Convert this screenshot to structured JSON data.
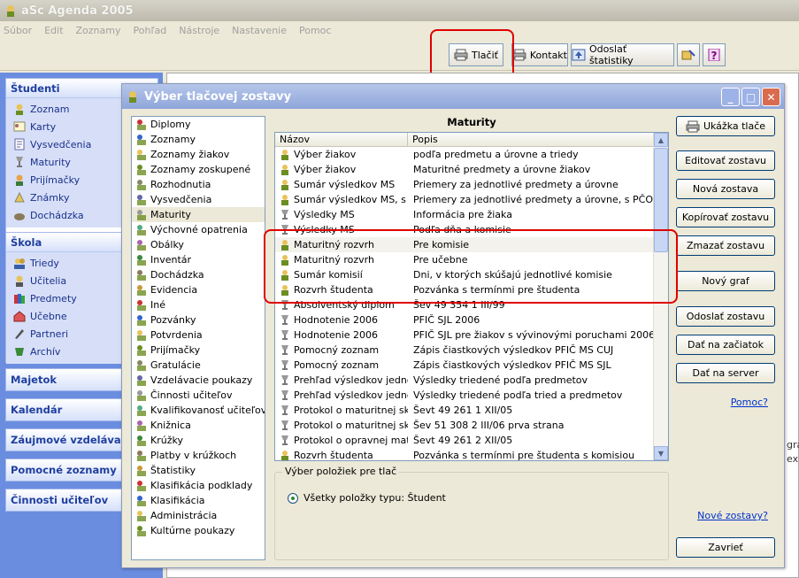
{
  "app": {
    "title": "aSc Agenda 2005"
  },
  "menu": [
    "Súbor",
    "Edit",
    "Zoznamy",
    "Pohľad",
    "Nástroje",
    "Nastavenie",
    "Pomoc"
  ],
  "toolbar": {
    "print_label": "Tlačiť",
    "contact_label": "Kontakt",
    "stats_label": "Odoslať štatistiky"
  },
  "nav": {
    "students": {
      "title": "Študenti",
      "items": [
        "Zoznam",
        "Karty",
        "Vysvedčenia",
        "Maturity",
        "Prijímačky",
        "Známky",
        "Dochádzka"
      ]
    },
    "school": {
      "title": "Škola",
      "items": [
        "Triedy",
        "Učitelia",
        "Predmety",
        "Učebne",
        "Partneri",
        "Archív"
      ]
    },
    "collapsed": [
      "Majetok",
      "Kalendár",
      "Záujmové vzdelávanie",
      "Pomocné zoznamy",
      "Činnosti učiteľov"
    ]
  },
  "dialog": {
    "title": "Výber tlačovej zostavy",
    "categories": [
      "Diplomy",
      "Zoznamy",
      "Zoznamy žiakov",
      "Zoznamy zoskupené",
      "Rozhodnutia",
      "Vysvedčenia",
      "Maturity",
      "Výchovné opatrenia",
      "Obálky",
      "Inventár",
      "Dochádzka",
      "Evidencia",
      "Iné",
      "Pozvánky",
      "Potvrdenia",
      "Prijímačky",
      "Gratulácie",
      "Vzdelávacie poukazy",
      "Činnosti učiteľov",
      "Kvalifikovanosť učiteľov",
      "Knižnica",
      "Krúžky",
      "Platby v krúžkoch",
      "Štatistiky",
      "Klasifikácia podklady",
      "Klasifikácia",
      "Administrácia",
      "Kultúrne poukazy"
    ],
    "selected_category": "Maturity",
    "panel_title": "Maturity",
    "columns": {
      "name": "Názov",
      "description": "Popis"
    },
    "rows": [
      {
        "name": "Výber žiakov",
        "desc": "podľa predmetu a úrovne a triedy"
      },
      {
        "name": "Výber žiakov",
        "desc": "Maturitné predmety a úrovne žiakov"
      },
      {
        "name": "Sumár výsledkov MS",
        "desc": "Priemery za jednotlivé predmety a úrovne"
      },
      {
        "name": "Sumár výsledkov MS, s ...",
        "desc": "Priemery za jednotlivé predmety a úrovne, s PČOZ"
      },
      {
        "name": "Výsledky MS",
        "desc": "Informácia pre žiaka"
      },
      {
        "name": "Výsledky MS",
        "desc": "Podľa dňa a komisie"
      },
      {
        "name": "Maturitný rozvrh",
        "desc": "Pre komisie"
      },
      {
        "name": "Maturitný rozvrh",
        "desc": "Pre učebne"
      },
      {
        "name": "Sumár komisií",
        "desc": "Dni, v ktorých skúšajú jednotlivé komisie"
      },
      {
        "name": "Rozvrh študenta",
        "desc": "Pozvánka s termínmi pre študenta"
      },
      {
        "name": "Absolventský diplom",
        "desc": "Šev 49 354 1 III/99"
      },
      {
        "name": "Hodnotenie 2006",
        "desc": "PFIČ SJL 2006"
      },
      {
        "name": "Hodnotenie 2006",
        "desc": "PFIČ SJL pre žiakov s vývinovými poruchami 2006"
      },
      {
        "name": "Pomocný zoznam",
        "desc": "Zápis čiastkových výsledkov PFIČ MS CUJ"
      },
      {
        "name": "Pomocný zoznam",
        "desc": "Zápis čiastkových výsledkov PFIČ MS SJL"
      },
      {
        "name": "Prehľad výsledkov jedno...",
        "desc": "Výsledky triedené podľa predmetov"
      },
      {
        "name": "Prehľad výsledkov jedno...",
        "desc": "Výsledky triedené podľa tried a predmetov"
      },
      {
        "name": "Protokol o maturitnej skú...",
        "desc": "Ševt 49 261 1 XII/05"
      },
      {
        "name": "Protokol o maturitnej skú...",
        "desc": "Šev 51 308 2 III/06 prva strana"
      },
      {
        "name": "Protokol o opravnej matu...",
        "desc": "Ševt 49 261 2 XII/05"
      },
      {
        "name": "Rozvrh študenta",
        "desc": "Pozvánka s termínmi pre študenta s komisiou"
      }
    ],
    "selection_group": "Výber položiek pre tlač",
    "selection_option": "Všetky položky typu: Študent",
    "buttons": {
      "preview": "Ukážka tlače",
      "edit": "Editovať zostavu",
      "new": "Nová zostava",
      "copy": "Kopírovať zostavu",
      "delete": "Zmazať zostavu",
      "new_graph": "Nový graf",
      "send": "Odoslať zostavu",
      "to_start": "Dať na začiatok",
      "to_server": "Dať na server",
      "close": "Zavrieť"
    },
    "links": {
      "help": "Pomoc?",
      "new_reports": "Nové zostavy?"
    }
  },
  "background": {
    "text_fragment": "gra",
    "text_fragment2": "ex"
  },
  "colors": {
    "nav_bg": "#6a8de0",
    "highlight": "#e00000",
    "link": "#0033cc"
  }
}
